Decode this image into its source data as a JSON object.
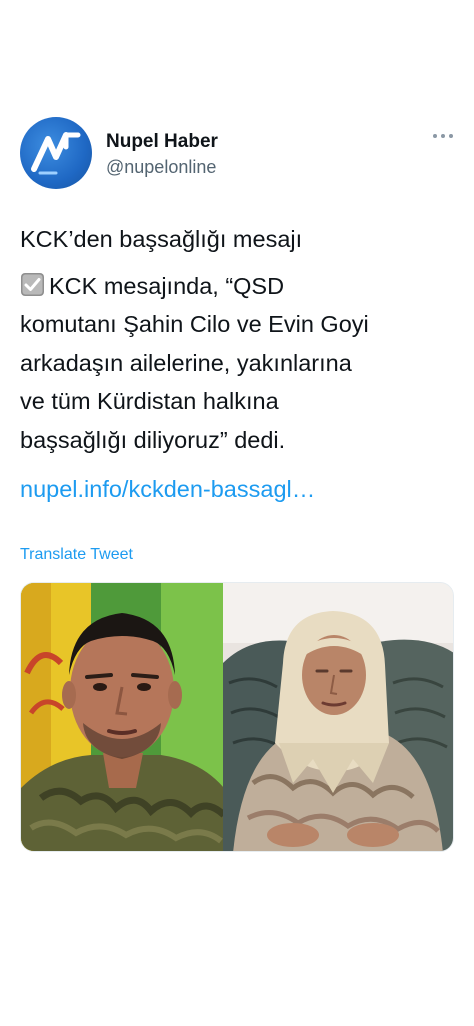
{
  "author": {
    "name": "Nupel Haber",
    "handle": "@nupelonline",
    "avatar_icon": "nupel-logo-icon"
  },
  "menu": {
    "icon": "more-dots-icon"
  },
  "tweet": {
    "title": "KCK’den başsağlığı mesajı",
    "check_icon": "check-box-icon",
    "lines": [
      "KCK mesajında, “QSD",
      "komutanı Şahin Cilo ve Evin Goyi",
      "arkadaşın ailelerine, yakınlarına",
      "ve tüm Kürdistan halkına",
      "başsağlığı diliyoruz” dedi."
    ],
    "link": "nupel.info/kckden-bassagl…",
    "translate": "Translate Tweet"
  },
  "colors": {
    "link": "#1d9bf0",
    "text": "#0f1419",
    "secondary": "#536471",
    "avatar_blue": "#1f68c4"
  }
}
